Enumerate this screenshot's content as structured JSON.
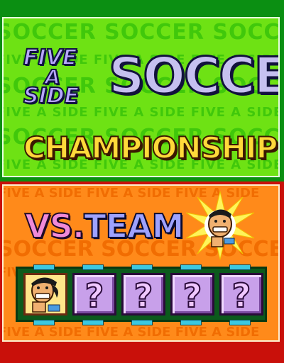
{
  "title": {
    "line_five": "FIVE",
    "line_a": "A",
    "line_side": "SIDE",
    "line_soccer": "SOCCER",
    "line_championship": "CHAMPIONSHIP",
    "pattern_big": "SOCCER   SOCCER   SOCCER   SOCCER",
    "pattern_small": "FIVE A SIDE   FIVE A SIDE   FIVE A SIDE   FIVE A SIDE"
  },
  "vs": {
    "vs_text": "VS.",
    "team_text": "TEAM",
    "pattern_big": "SOCCER   SOCCER   SOCCER",
    "pattern_small": "FIVE A SIDE   FIVE A SIDE   FIVE A SIDE",
    "slots": [
      {
        "kind": "player"
      },
      {
        "kind": "unknown",
        "symbol": "?"
      },
      {
        "kind": "unknown",
        "symbol": "?"
      },
      {
        "kind": "unknown",
        "symbol": "?"
      },
      {
        "kind": "unknown",
        "symbol": "?"
      }
    ]
  },
  "colors": {
    "title_bg": "#6ee214",
    "vs_bg": "#ff8a1a",
    "outer_top": "#0b8f12",
    "outer_bottom": "#c9100a"
  }
}
